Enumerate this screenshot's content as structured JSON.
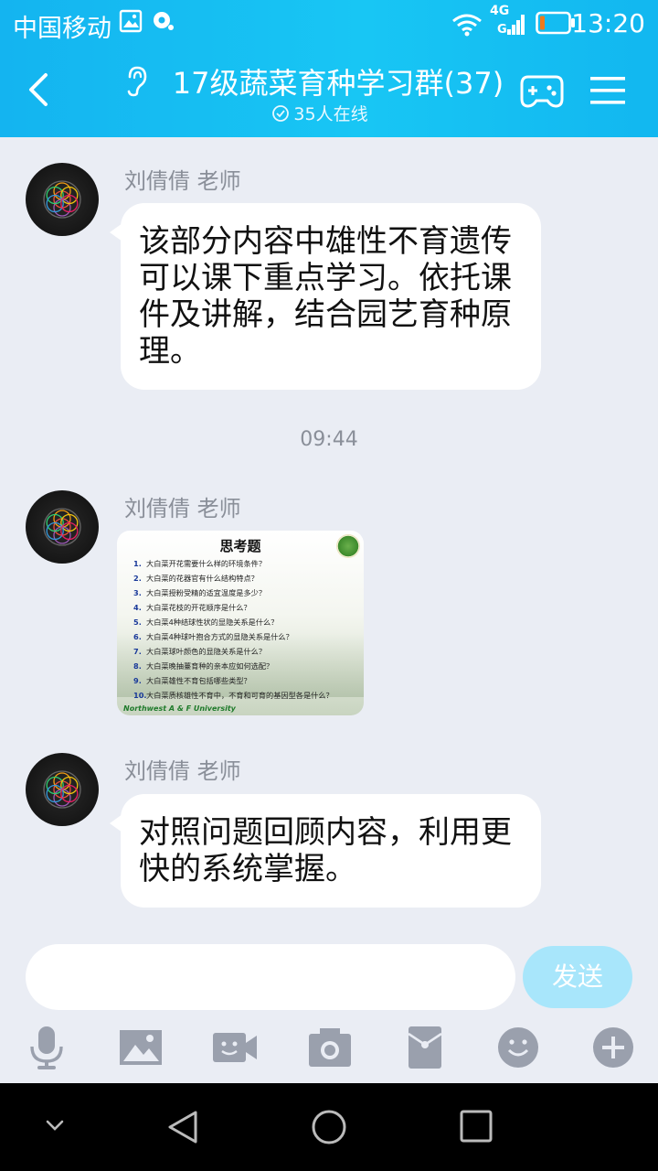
{
  "status_bar": {
    "carrier": "中国移动",
    "network": "4G",
    "time": "13:20"
  },
  "header": {
    "title": "17级蔬菜育种学习群(37)",
    "online": "35人在线",
    "icons": [
      "back-arrow-icon",
      "ear-icon",
      "gamepad-icon",
      "menu-icon"
    ]
  },
  "messages": [
    {
      "sender": "刘倩倩 老师",
      "text": "该部分内容中雄性不育遗传可以课下重点学习。依托课件及讲解，结合园艺育种原理。"
    },
    {
      "timestamp": "09:44"
    },
    {
      "sender": "刘倩倩 老师",
      "image": {
        "title": "思考题",
        "items": [
          "大白菜开花需要什么样的环境条件？",
          "大白菜的花器官有什么结构特点？",
          "大白菜授粉受精的适宜温度是多少？",
          "大白菜花枝的开花顺序是什么？",
          "大白菜4种结球性状的显隐关系是什么？",
          "大白菜4种球叶抱合方式的显隐关系是什么？",
          "大白菜球叶颜色的显隐关系是什么？",
          "大白菜晚抽薹育种的亲本应如何选配？",
          "大白菜雄性不育包括哪些类型？",
          "大白菜质核雄性不育中，不育和可育的基因型各是什么？"
        ],
        "footer": "Northwest A & F University"
      }
    },
    {
      "sender": "刘倩倩 老师",
      "text": "对照问题回顾内容，利用更快的系统掌握。"
    }
  ],
  "input": {
    "value": "",
    "send_label": "发送"
  },
  "toolbar": [
    "microphone-icon",
    "image-icon",
    "video-call-icon",
    "camera-icon",
    "red-packet-icon",
    "emoji-icon",
    "plus-icon"
  ],
  "colors": {
    "header": "#14b4f0",
    "send_button": "#a8e6fb",
    "background": "#eaedf4"
  }
}
